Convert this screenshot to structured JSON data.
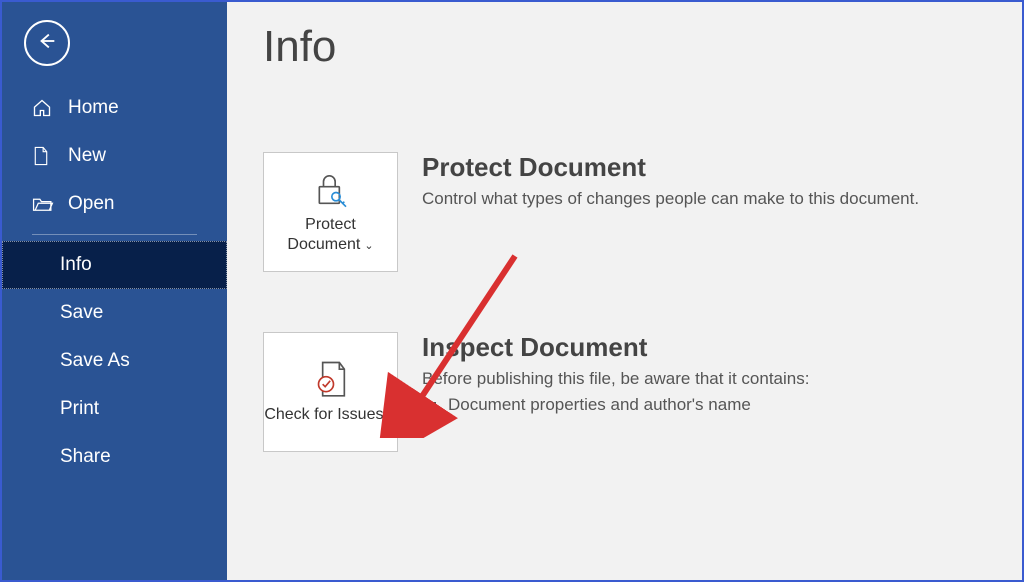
{
  "sidebar": {
    "items": [
      {
        "label": "Home"
      },
      {
        "label": "New"
      },
      {
        "label": "Open"
      },
      {
        "label": "Info"
      },
      {
        "label": "Save"
      },
      {
        "label": "Save As"
      },
      {
        "label": "Print"
      },
      {
        "label": "Share"
      }
    ]
  },
  "page": {
    "title": "Info"
  },
  "protect": {
    "tile_label": "Protect Document",
    "heading": "Protect Document",
    "desc": "Control what types of changes people can make to this document."
  },
  "inspect": {
    "tile_label": "Check for Issues",
    "heading": "Inspect Document",
    "desc": "Before publishing this file, be aware that it contains:",
    "issues": [
      "Document properties and author's name"
    ]
  }
}
